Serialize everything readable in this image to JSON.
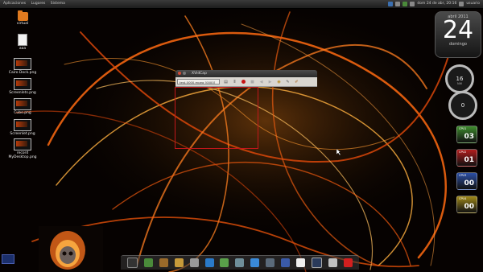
{
  "top_panel": {
    "menu": [
      "Aplicaciones",
      "Lugares",
      "Sistema"
    ],
    "clock": "dom 24 de abr, 20:16",
    "user": "usuario"
  },
  "desktop_icons": [
    {
      "label": "virtual",
      "icon": "folder-icon"
    },
    {
      "label": "aaa",
      "icon": "text-file-icon"
    },
    {
      "label": "Cairo Dock.png",
      "icon": "image-file-icon"
    },
    {
      "label": "Screenlets.png",
      "icon": "image-file-icon"
    },
    {
      "label": "Cubo.png",
      "icon": "image-file-icon"
    },
    {
      "label": "Screenlet.png",
      "icon": "image-file-icon"
    },
    {
      "label": "record MyDesktop.png",
      "icon": "image-file-icon"
    }
  ],
  "xvidcap": {
    "title": "XVidCap",
    "file": "test-0000.mpeg [0000]"
  },
  "calendar": {
    "month": "abril 2011",
    "day": "24",
    "weekday": "domingo"
  },
  "gauges": [
    {
      "value": "16",
      "sub": "NW"
    },
    {
      "value": "0",
      "sub": ""
    }
  ],
  "cpus": [
    {
      "label": "CPU1",
      "value": "03",
      "color": "#3f8d2e"
    },
    {
      "label": "CPU2",
      "value": "01",
      "color": "#b31d1d"
    },
    {
      "label": "CPU3",
      "value": "00",
      "color": "#2c4fa6"
    },
    {
      "label": "CPU4",
      "value": "00",
      "color": "#a18a1a"
    }
  ],
  "dock_items": [
    "terminal-icon",
    "spreadsheet-icon",
    "tools-icon",
    "package-icon",
    "printer-icon",
    "image-icon",
    "folder-icon",
    "settings-icon",
    "network-icon",
    "mail-icon",
    "editor-icon",
    "text-icon",
    "monitor-icon",
    "screenshot-icon",
    "pdf-icon"
  ]
}
